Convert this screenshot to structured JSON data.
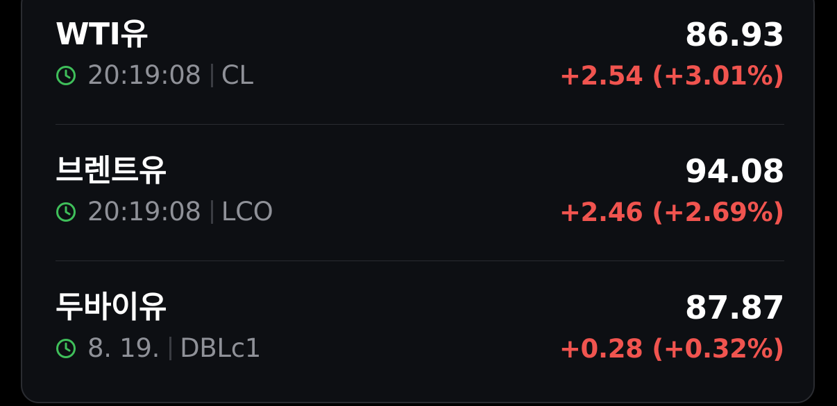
{
  "colors": {
    "background": "#0d0f13",
    "text_primary": "#ffffff",
    "text_secondary": "#8f9198",
    "change_up": "#f0544f",
    "clock_icon": "#3fbf5a"
  },
  "items": [
    {
      "name": "WTI유",
      "time": "20:19:08",
      "code": "CL",
      "price": "86.93",
      "change": "+2.54 (+3.01%)",
      "icon": "clock-icon"
    },
    {
      "name": "브렌트유",
      "time": "20:19:08",
      "code": "LCO",
      "price": "94.08",
      "change": "+2.46 (+2.69%)",
      "icon": "clock-icon"
    },
    {
      "name": "두바이유",
      "time": "8. 19.",
      "code": "DBLc1",
      "price": "87.87",
      "change": "+0.28 (+0.32%)",
      "icon": "clock-icon"
    }
  ]
}
